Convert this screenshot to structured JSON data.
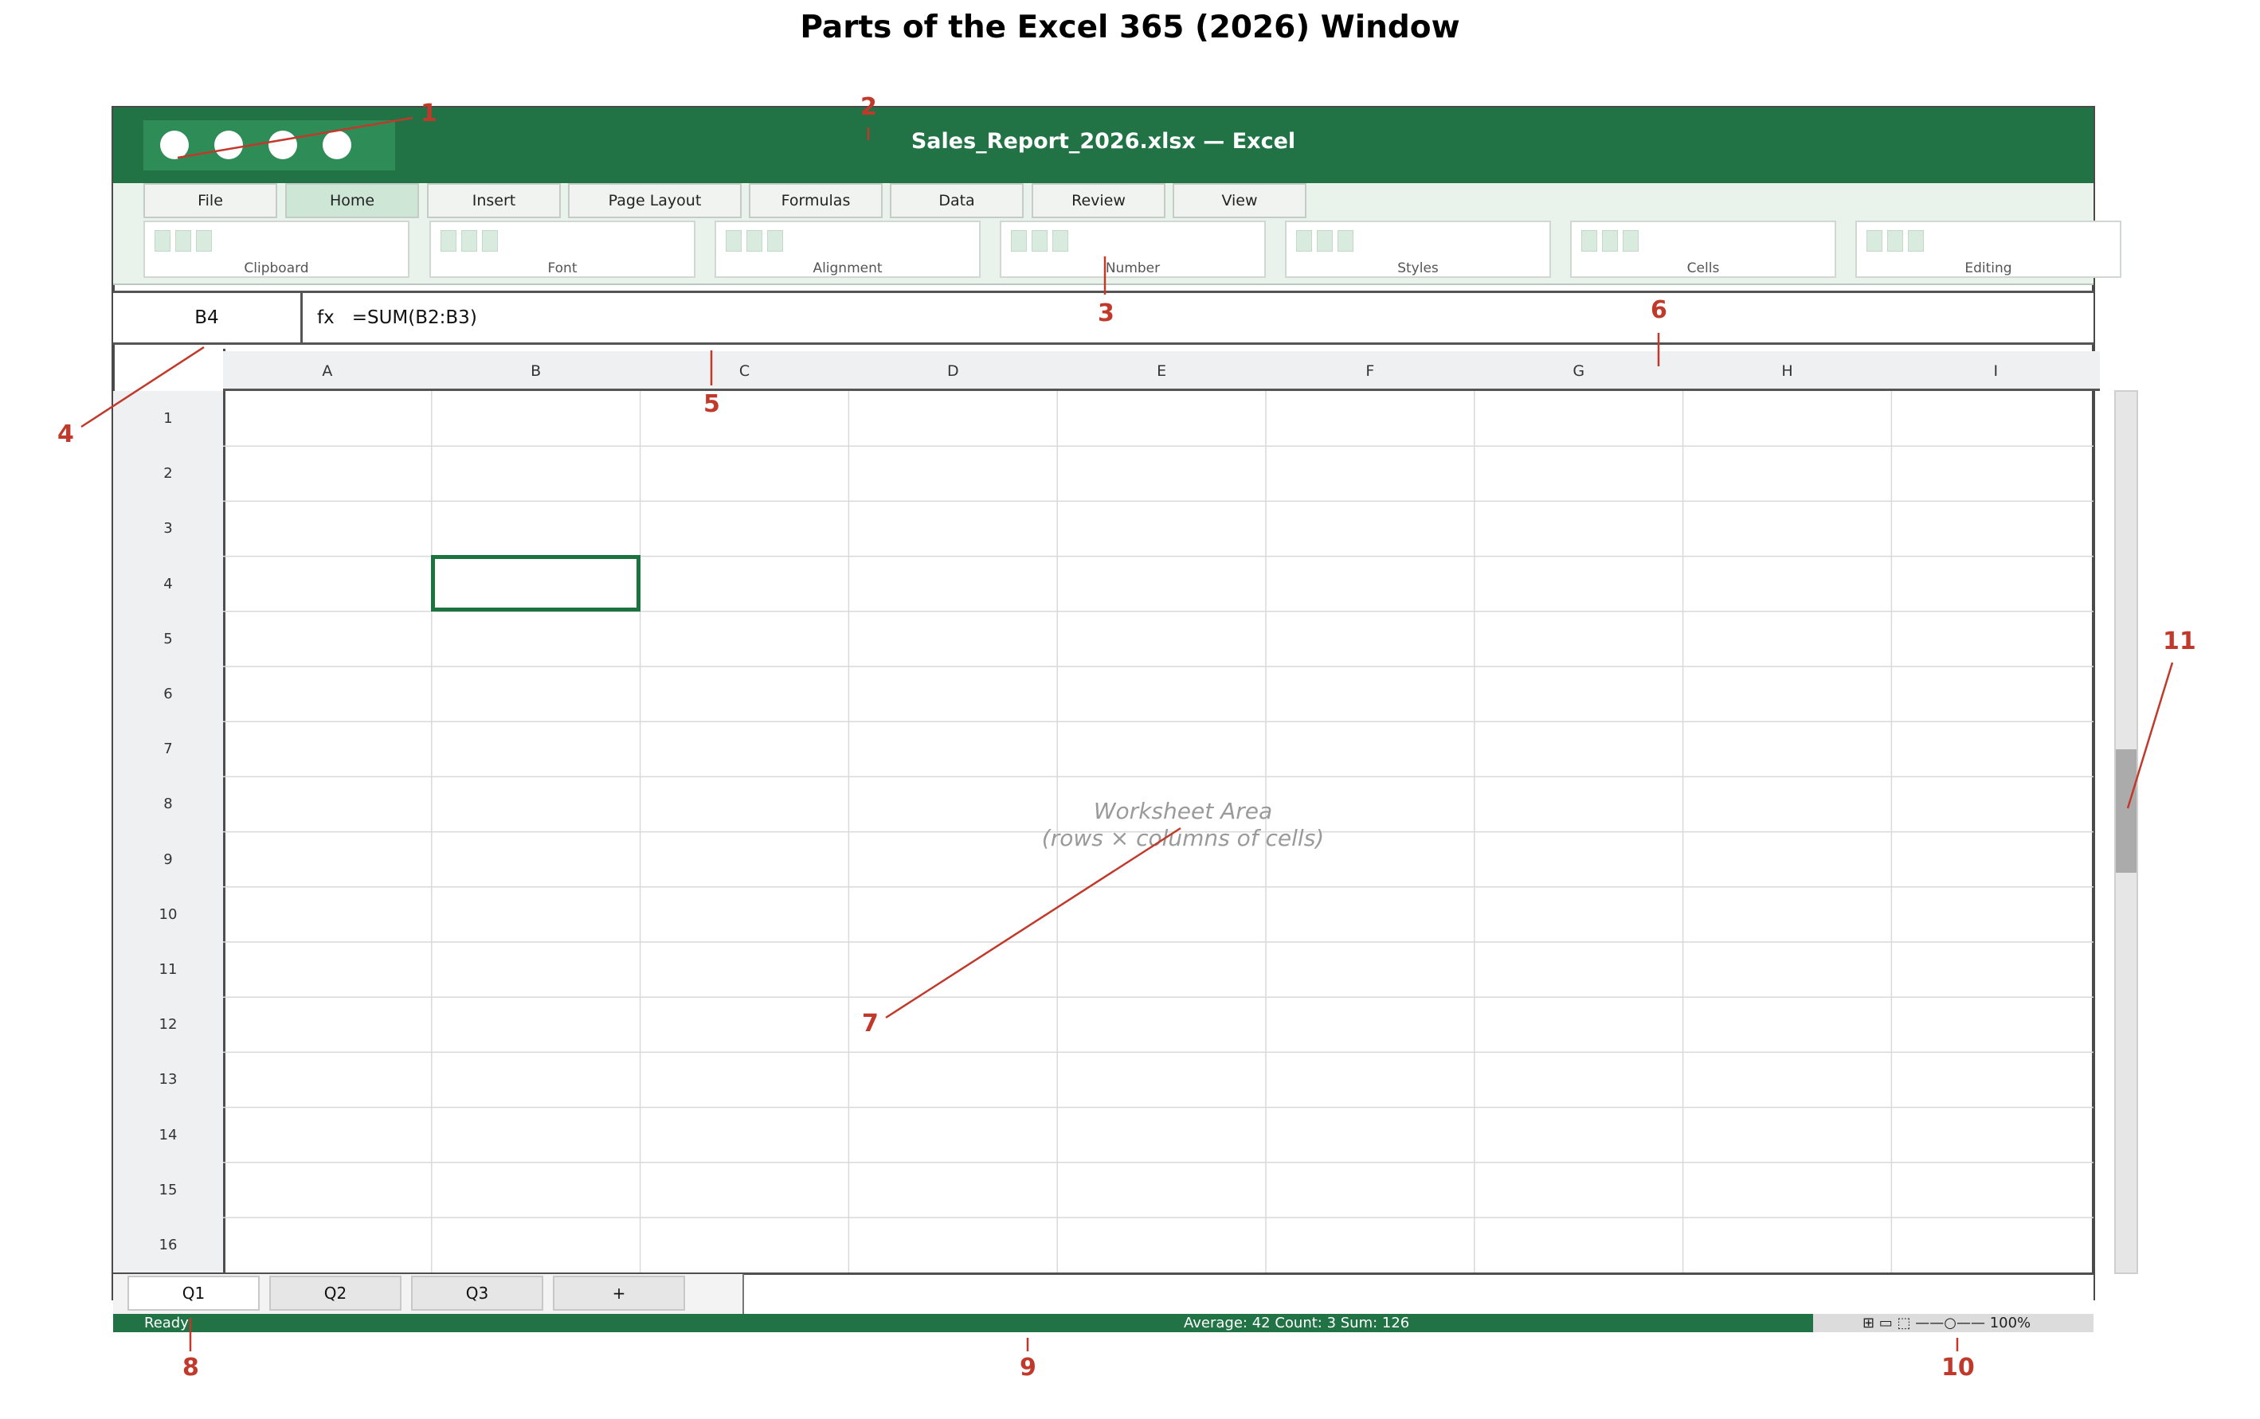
{
  "diagram_title": "Parts of the Excel 365 (2026) Window",
  "window": {
    "title": "Sales_Report_2026.xlsx  —  Excel",
    "quick_access_icons": [
      "circle-icon",
      "circle-icon",
      "circle-icon",
      "circle-icon"
    ]
  },
  "ribbon": {
    "tabs": [
      {
        "label": "File",
        "active": false
      },
      {
        "label": "Home",
        "active": true
      },
      {
        "label": "Insert",
        "active": false
      },
      {
        "label": "Page Layout",
        "active": false
      },
      {
        "label": "Formulas",
        "active": false
      },
      {
        "label": "Data",
        "active": false
      },
      {
        "label": "Review",
        "active": false
      },
      {
        "label": "View",
        "active": false
      }
    ],
    "groups": [
      "Clipboard",
      "Font",
      "Alignment",
      "Number",
      "Styles",
      "Cells",
      "Editing"
    ]
  },
  "formula_bar": {
    "name_box": "B4",
    "fx_label": "fx",
    "formula": "=SUM(B2:B3)"
  },
  "grid": {
    "columns": [
      "A",
      "B",
      "C",
      "D",
      "E",
      "F",
      "G",
      "H",
      "I"
    ],
    "rows": [
      "1",
      "2",
      "3",
      "4",
      "5",
      "6",
      "7",
      "8",
      "9",
      "10",
      "11",
      "12",
      "13",
      "14",
      "15",
      "16"
    ],
    "selected_cell": "B4"
  },
  "worksheet_caption": {
    "line1": "Worksheet Area",
    "line2": "(rows × columns of cells)"
  },
  "sheet_tabs": [
    {
      "label": "Q1",
      "active": true
    },
    {
      "label": "Q2",
      "active": false
    },
    {
      "label": "Q3",
      "active": false
    },
    {
      "label": "+",
      "active": false
    }
  ],
  "status_bar": {
    "ready": "Ready",
    "stats": "Average: 42   Count: 3   Sum: 126",
    "view_controls": "⊞ ▭ ⬚   ——○——  100%"
  },
  "callouts": [
    "1",
    "2",
    "3",
    "4",
    "5",
    "6",
    "7",
    "8",
    "9",
    "10",
    "11"
  ],
  "colors": {
    "excel_green": "#217346",
    "callout_red": "#c0392b"
  }
}
